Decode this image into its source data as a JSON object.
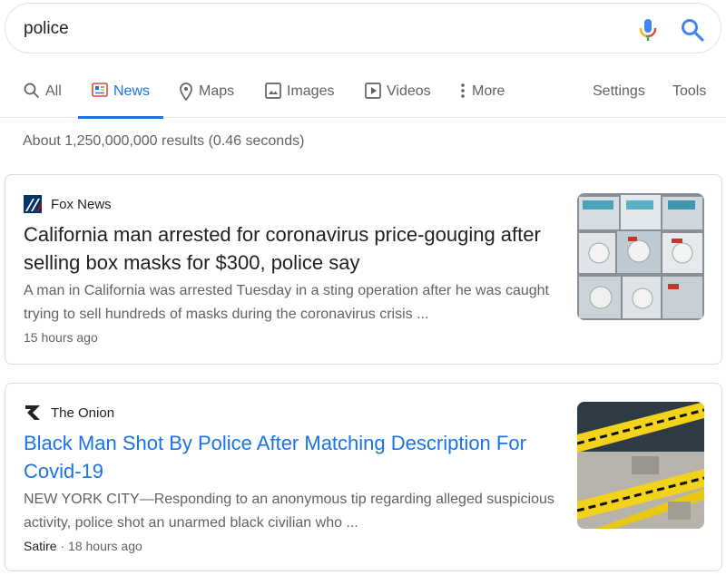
{
  "search": {
    "value": "police",
    "placeholder": ""
  },
  "tabs": [
    {
      "label": "All",
      "icon": "search-icon"
    },
    {
      "label": "News",
      "icon": "news-icon",
      "active": true
    },
    {
      "label": "Maps",
      "icon": "map-pin-icon"
    },
    {
      "label": "Images",
      "icon": "image-icon"
    },
    {
      "label": "Videos",
      "icon": "video-icon"
    },
    {
      "label": "More",
      "icon": "more-vertical-icon"
    }
  ],
  "tools": {
    "settings": "Settings",
    "tools": "Tools"
  },
  "result_stats": "About 1,250,000,000 results (0.46 seconds)",
  "results": [
    {
      "source": "Fox News",
      "headline": "California man arrested for coronavirus price-gouging after selling box masks for $300, police say",
      "snippet": "A man in California was arrested Tuesday in a sting operation after he was caught trying to sell hundreds of masks during the coronavirus crisis ...",
      "time": "15 hours ago",
      "label": ""
    },
    {
      "source": "The Onion",
      "headline": "Black Man Shot By Police After Matching Description For Covid-19",
      "snippet": "NEW YORK CITY—Responding to an anonymous tip regarding alleged suspicious activity, police shot an unarmed black civilian who ...",
      "time": "18 hours ago",
      "label": "Satire"
    }
  ],
  "colors": {
    "accent": "#1a73e8",
    "text_muted": "#5f6368",
    "border": "#dadce0"
  }
}
